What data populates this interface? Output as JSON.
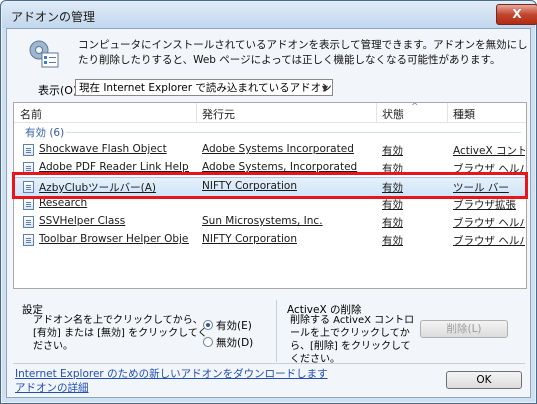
{
  "window": {
    "title": "アドオンの管理",
    "close_glyph": "X"
  },
  "description": "コンピュータにインストールされているアドオンを表示して管理できます。アドオンを無効にしたり削除したりすると、Web ページによっては正しく機能しなくなる可能性があります。",
  "show": {
    "label": "表示(O):",
    "selected": "現在 Internet Explorer で読み込まれているアドオン"
  },
  "columns": {
    "name": "名前",
    "publisher": "発行元",
    "status": "状態",
    "type": "種類"
  },
  "group": {
    "label": "有効 (6)"
  },
  "rows": [
    {
      "name": "Shockwave Flash Object",
      "publisher": "Adobe Systems Incorporated",
      "status": "有効",
      "type": "ActiveX コントロール"
    },
    {
      "name": "Adobe PDF Reader Link Helper",
      "publisher": "Adobe Systems, Incorporated",
      "status": "有効",
      "type": "ブラウザ ヘルパー"
    },
    {
      "name": "AzbyClubツールバー(A)",
      "publisher": "NIFTY Corporation",
      "status": "有効",
      "type": "ツール バー"
    },
    {
      "name": "Research",
      "publisher": "",
      "status": "有効",
      "type": "ブラウザ拡張"
    },
    {
      "name": "SSVHelper Class",
      "publisher": "Sun Microsystems, Inc.",
      "status": "有効",
      "type": "ブラウザ ヘルパー"
    },
    {
      "name": "Toolbar Browser Helper Objects",
      "publisher": "NIFTY Corporation",
      "status": "有効",
      "type": "ブラウザ ヘルパー"
    }
  ],
  "settings": {
    "title": "設定",
    "text": "アドオン名を上でクリックしてから、[有効] または [無効] をクリックしてください。",
    "enable_label": "有効(E)",
    "disable_label": "無効(D)"
  },
  "activex": {
    "title": "ActiveX の削除",
    "text": "削除する ActiveX コントロールを上でクリックしてから、[削除] をクリックしてください。",
    "delete_label": "削除(L)"
  },
  "links": {
    "download": "Internet Explorer のための新しいアドオンをダウンロードします",
    "details": "アドオンの詳細"
  },
  "ok_label": "OK",
  "colors": {
    "highlight": "#e8151b",
    "link": "#1f4fb6"
  }
}
